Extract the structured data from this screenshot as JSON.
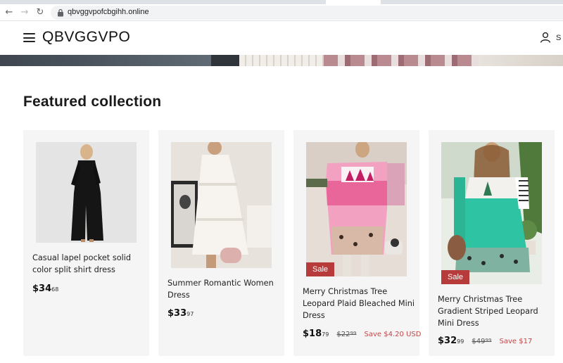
{
  "browser": {
    "url": "qbvggvpofcbgihh.online"
  },
  "header": {
    "store_name": "QBVGGVPO",
    "account_label": "S"
  },
  "section": {
    "title": "Featured collection"
  },
  "products": [
    {
      "title": "Casual lapel pocket solid color split shirt dress",
      "price_dollars": "$34",
      "price_cents": "68",
      "on_sale": false
    },
    {
      "title": "Summer Romantic Women Dress",
      "price_dollars": "$33",
      "price_cents": "97",
      "on_sale": false
    },
    {
      "title": "Merry Christmas Tree Leopard Plaid Bleached Mini Dress",
      "price_dollars": "$18",
      "price_cents": "79",
      "compare_dollars": "$22",
      "compare_cents": "99",
      "save_text": "Save $4.20 USD",
      "badge": "Sale",
      "on_sale": true
    },
    {
      "title": "Merry Christmas Tree Gradient Striped Leopard Mini Dress",
      "price_dollars": "$32",
      "price_cents": "99",
      "compare_dollars": "$49",
      "compare_cents": "99",
      "save_text": "Save $17",
      "badge": "Sale",
      "on_sale": true
    }
  ],
  "colors": {
    "sale_badge": "#b73b3b",
    "save_text": "#c0474a",
    "card_background": "#f5f5f5"
  }
}
